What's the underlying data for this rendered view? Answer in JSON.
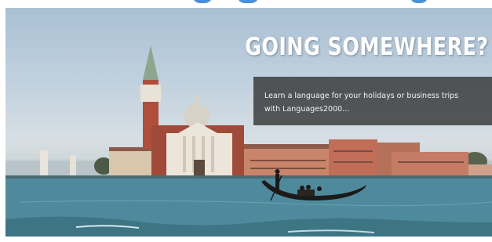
{
  "hero": {
    "headline": "GOING SOMEWHERE?",
    "promo_text": "Learn a language for your holidays or business trips with Languages2000..."
  },
  "colors": {
    "accent_heading": "#4a90d9",
    "promo_box": "#3c3c3c",
    "water": "#4f8a9c",
    "sky": "#c3d2df"
  },
  "image": {
    "subject": "gondola-on-lagoon-with-church-and-bell-tower"
  }
}
